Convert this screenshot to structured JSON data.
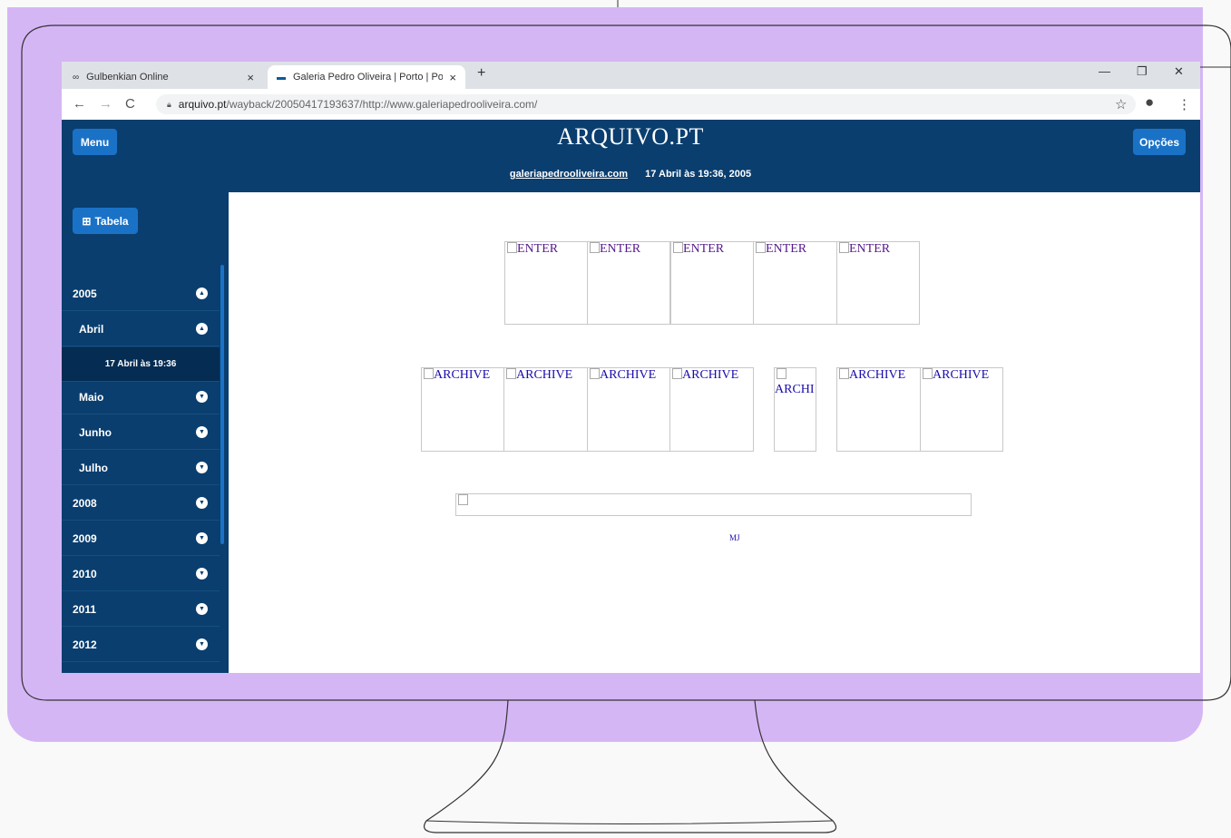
{
  "colors": {
    "frame": "#d5b6f5",
    "header": "#0a3e6f",
    "button": "#1a72c7"
  },
  "browser": {
    "tabs": [
      {
        "label": "Gulbenkian Online",
        "icon": "gulbenkian-favicon",
        "close": "×"
      },
      {
        "label": "Galeria Pedro Oliveira | Porto | Po",
        "icon": "galeria-favicon",
        "close": "×"
      }
    ],
    "new_tab": "+",
    "url_host": "arquivo.pt",
    "url_path": "/wayback/20050417193637/http://www.galeriapedrooliveira.com/"
  },
  "header": {
    "menu_label": "Menu",
    "logo": "ARQUIVO.PT",
    "options_label": "Opções",
    "site": "galeriapedrooliveira.com",
    "date": "17 Abril às 19:36, 2005"
  },
  "sidebar": {
    "table_label": "Tabela",
    "rows": [
      {
        "label": "2005",
        "kind": "year",
        "expanded": true
      },
      {
        "label": "Abril",
        "kind": "month",
        "expanded": true
      },
      {
        "label": "17 Abril às 19:36",
        "kind": "day"
      },
      {
        "label": "Maio",
        "kind": "month",
        "expanded": false
      },
      {
        "label": "Junho",
        "kind": "month",
        "expanded": false
      },
      {
        "label": "Julho",
        "kind": "month",
        "expanded": false
      },
      {
        "label": "2008",
        "kind": "year",
        "expanded": false
      },
      {
        "label": "2009",
        "kind": "year",
        "expanded": false
      },
      {
        "label": "2010",
        "kind": "year",
        "expanded": false
      },
      {
        "label": "2011",
        "kind": "year",
        "expanded": false
      },
      {
        "label": "2012",
        "kind": "year",
        "expanded": false
      }
    ]
  },
  "content": {
    "enter_images": [
      "ENTER",
      "ENTER",
      "ENTER",
      "ENTER",
      "ENTER"
    ],
    "archive_images": [
      "ARCHIVE",
      "ARCHIVE",
      "ARCHIVE",
      "ARCHIVE",
      "ARCHI",
      "ARCHIVE",
      "ARCHIVE"
    ],
    "footer_link": "MJ"
  }
}
